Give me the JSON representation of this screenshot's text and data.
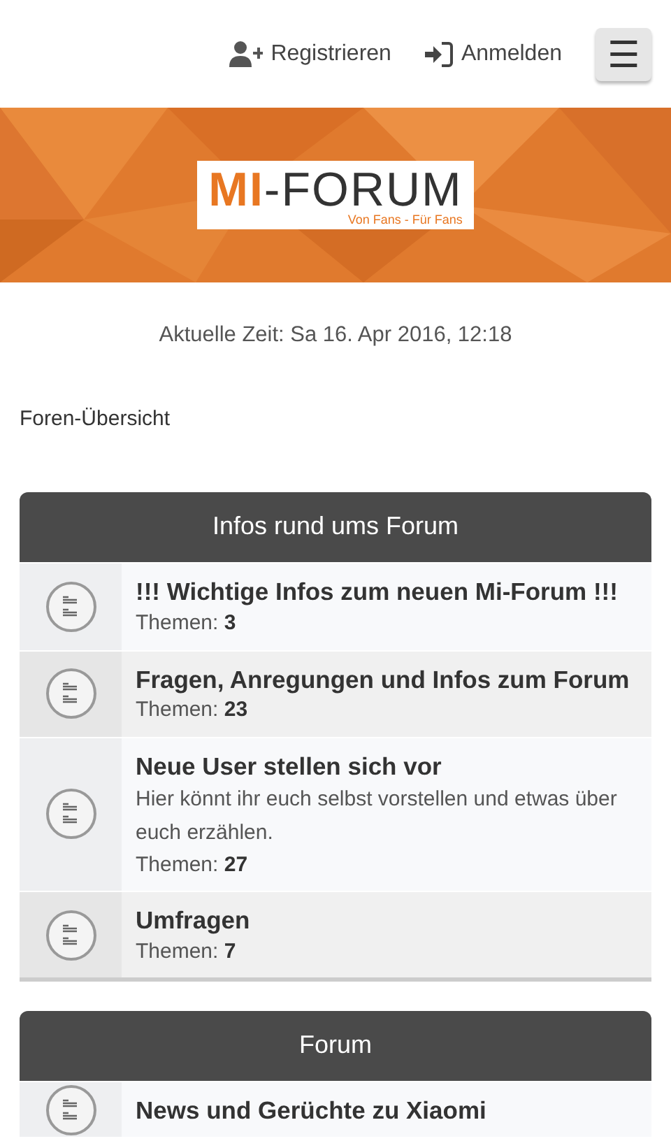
{
  "header": {
    "links": [
      {
        "label": "Registrieren",
        "kind": "register"
      },
      {
        "label": "Anmelden",
        "kind": "login"
      }
    ],
    "menu_button": {
      "label": "☰"
    }
  },
  "logo": {
    "mark": "MI",
    "name": "-FORUM",
    "tagline": "Von Fans - Für Fans"
  },
  "current_time": "Aktuelle Zeit: Sa 16. Apr 2016, 12:18",
  "breadcrumb": "Foren-Übersicht",
  "categories": [
    {
      "title": "Infos rund ums Forum",
      "forums": [
        {
          "title": "!!! Wichtige Infos zum neuen Mi-Forum !!!",
          "topics_label": "Themen:",
          "topics_count": "3"
        },
        {
          "title": "Fragen, Anregungen und Infos zum Forum",
          "topics_label": "Themen:",
          "topics_count": "23"
        },
        {
          "title": "Neue User stellen sich vor",
          "description": "Hier könnt ihr euch selbst vorstellen und etwas über euch erzählen.",
          "topics_label": "Themen:",
          "topics_count": "27"
        },
        {
          "title": "Umfragen",
          "topics_label": "Themen:",
          "topics_count": "7"
        }
      ]
    },
    {
      "title": "Forum",
      "forums": [
        {
          "title": "News und Gerüchte zu Xiaomi"
        }
      ]
    }
  ]
}
